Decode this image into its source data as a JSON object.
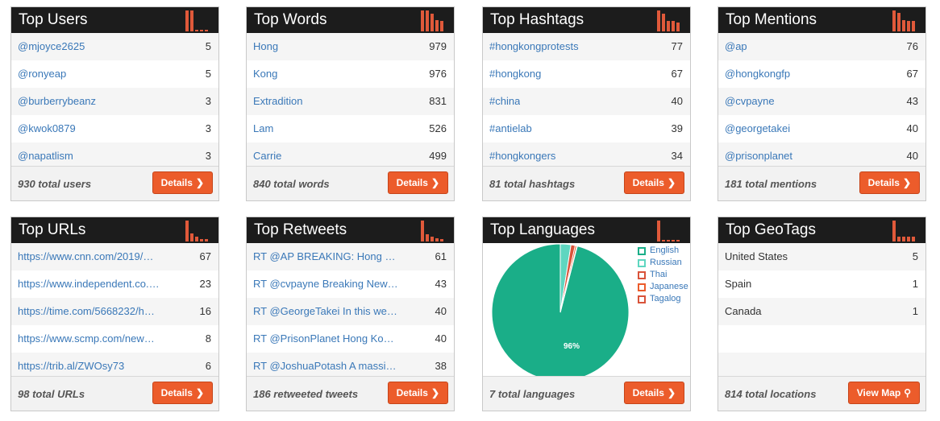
{
  "colors": {
    "accent": "#ec5c2b",
    "header_bg": "#1c1c1c",
    "link": "#3a78b8",
    "pie_main": "#1aae88",
    "pie_secondary": "#5fd6c0",
    "pie_other": "#d9533a"
  },
  "details_label": "Details",
  "cards": {
    "users": {
      "title": "Top Users",
      "rows": [
        {
          "label": "@mjoyce2625",
          "value": "5"
        },
        {
          "label": "@ronyeap",
          "value": "5"
        },
        {
          "label": "@burberrybeanz",
          "value": "3"
        },
        {
          "label": "@kwok0879",
          "value": "3"
        },
        {
          "label": "@napatlism",
          "value": "3"
        }
      ],
      "total": "930 total users"
    },
    "words": {
      "title": "Top Words",
      "rows": [
        {
          "label": "Hong",
          "value": "979"
        },
        {
          "label": "Kong",
          "value": "976"
        },
        {
          "label": "Extradition",
          "value": "831"
        },
        {
          "label": "Lam",
          "value": "526"
        },
        {
          "label": "Carrie",
          "value": "499"
        }
      ],
      "total": "840 total words"
    },
    "hashtags": {
      "title": "Top Hashtags",
      "rows": [
        {
          "label": "#hongkongprotests",
          "value": "77"
        },
        {
          "label": "#hongkong",
          "value": "67"
        },
        {
          "label": "#china",
          "value": "40"
        },
        {
          "label": "#antielab",
          "value": "39"
        },
        {
          "label": "#hongkongers",
          "value": "34"
        }
      ],
      "total": "81 total hashtags"
    },
    "mentions": {
      "title": "Top Mentions",
      "rows": [
        {
          "label": "@ap",
          "value": "76"
        },
        {
          "label": "@hongkongfp",
          "value": "67"
        },
        {
          "label": "@cvpayne",
          "value": "43"
        },
        {
          "label": "@georgetakei",
          "value": "40"
        },
        {
          "label": "@prisonplanet",
          "value": "40"
        }
      ],
      "total": "181 total mentions"
    },
    "urls": {
      "title": "Top URLs",
      "rows": [
        {
          "label": "https://www.cnn.com/2019/…",
          "value": "67"
        },
        {
          "label": "https://www.independent.co.…",
          "value": "23"
        },
        {
          "label": "https://time.com/5668232/h…",
          "value": "16"
        },
        {
          "label": "https://www.scmp.com/new…",
          "value": "8"
        },
        {
          "label": "https://trib.al/ZWOsy73",
          "value": "6"
        }
      ],
      "total": "98 total URLs"
    },
    "retweets": {
      "title": "Top Retweets",
      "rows": [
        {
          "label": "RT @AP BREAKING: Hong Ko…",
          "value": "61"
        },
        {
          "label": "RT @cvpayne Breaking News …",
          "value": "43"
        },
        {
          "label": "RT @GeorgeTakei In this wee…",
          "value": "40"
        },
        {
          "label": "RT @PrisonPlanet Hong Kon…",
          "value": "40"
        },
        {
          "label": "RT @JoshuaPotash A massiv…",
          "value": "38"
        }
      ],
      "total": "186 retweeted tweets"
    },
    "languages": {
      "title": "Top Languages",
      "legend": [
        "English",
        "Russian",
        "Thai",
        "Japanese",
        "Tagalog"
      ],
      "legend_colors": [
        "#1aae88",
        "#5fd6c0",
        "#d9533a",
        "#ec5c2b",
        "#d9533a"
      ],
      "slices_fraction": [
        0.96,
        0.025,
        0.01,
        0.004,
        0.001
      ],
      "pie_label": "96%",
      "total": "7 total languages"
    },
    "geotags": {
      "title": "Top GeoTags",
      "rows": [
        {
          "label": "United States",
          "value": "5"
        },
        {
          "label": "Spain",
          "value": "1"
        },
        {
          "label": "Canada",
          "value": "1"
        }
      ],
      "total": "814 total locations",
      "map_button": "View Map"
    }
  },
  "icons": {
    "details": "chevron-right-icon",
    "map": "map-marker-icon",
    "mini_chart": "bar-chart-icon"
  }
}
